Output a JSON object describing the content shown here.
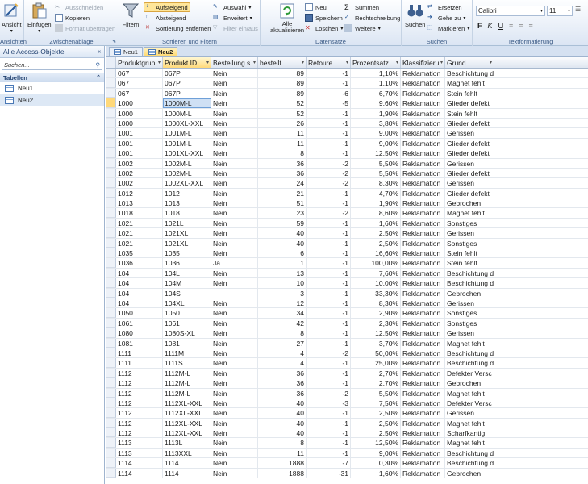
{
  "ribbon": {
    "views": {
      "label": "Ansicht",
      "group": "Ansichten"
    },
    "clipboard": {
      "group": "Zwischenablage",
      "paste": "Einfügen",
      "cut": "Ausschneiden",
      "copy": "Kopieren",
      "format": "Format übertragen"
    },
    "sort": {
      "group": "Sortieren und Filtern",
      "filter": "Filtern",
      "asc": "Aufsteigend",
      "desc": "Absteigend",
      "remove": "Sortierung entfernen",
      "selection": "Auswahl",
      "advanced": "Erweitert",
      "toggle": "Filter ein/aus"
    },
    "records": {
      "group": "Datensätze",
      "refresh": "Alle aktualisieren",
      "new": "Neu",
      "save": "Speichern",
      "delete": "Löschen",
      "totals": "Summen",
      "spelling": "Rechtschreibung",
      "more": "Weitere"
    },
    "find": {
      "group": "Suchen",
      "find": "Suchen",
      "replace": "Ersetzen",
      "goto": "Gehe zu",
      "select": "Markieren"
    },
    "text": {
      "group": "Textformatierung",
      "font": "Calibri",
      "size": "11",
      "bold": "F",
      "italic": "K",
      "underline": "U"
    }
  },
  "nav": {
    "title": "Alle Access-Objekte",
    "search_placeholder": "Suchen...",
    "section": "Tabellen",
    "items": [
      "Neu1",
      "Neu2"
    ]
  },
  "tabs": [
    "Neu1",
    "Neu2"
  ],
  "columns": [
    "Produktgrup",
    "Produkt ID",
    "Bestellung s",
    "bestellt",
    "Retoure",
    "Prozentsatz",
    "Klassifizieru",
    "Grund"
  ],
  "rows": [
    [
      "067",
      "067P",
      "Nein",
      "89",
      "-1",
      "1,10%",
      "Reklamation",
      "Beschichtung d"
    ],
    [
      "067",
      "067P",
      "Nein",
      "89",
      "-1",
      "1,10%",
      "Reklamation",
      "Magnet fehlt"
    ],
    [
      "067",
      "067P",
      "Nein",
      "89",
      "-6",
      "6,70%",
      "Reklamation",
      "Stein fehlt"
    ],
    [
      "1000",
      "1000M-L",
      "Nein",
      "52",
      "-5",
      "9,60%",
      "Reklamation",
      "Glieder defekt"
    ],
    [
      "1000",
      "1000M-L",
      "Nein",
      "52",
      "-1",
      "1,90%",
      "Reklamation",
      "Stein fehlt"
    ],
    [
      "1000",
      "1000XL-XXL",
      "Nein",
      "26",
      "-1",
      "3,80%",
      "Reklamation",
      "Glieder defekt"
    ],
    [
      "1001",
      "1001M-L",
      "Nein",
      "11",
      "-1",
      "9,00%",
      "Reklamation",
      "Gerissen"
    ],
    [
      "1001",
      "1001M-L",
      "Nein",
      "11",
      "-1",
      "9,00%",
      "Reklamation",
      "Glieder defekt"
    ],
    [
      "1001",
      "1001XL-XXL",
      "Nein",
      "8",
      "-1",
      "12,50%",
      "Reklamation",
      "Glieder defekt"
    ],
    [
      "1002",
      "1002M-L",
      "Nein",
      "36",
      "-2",
      "5,50%",
      "Reklamation",
      "Gerissen"
    ],
    [
      "1002",
      "1002M-L",
      "Nein",
      "36",
      "-2",
      "5,50%",
      "Reklamation",
      "Glieder defekt"
    ],
    [
      "1002",
      "1002XL-XXL",
      "Nein",
      "24",
      "-2",
      "8,30%",
      "Reklamation",
      "Gerissen"
    ],
    [
      "1012",
      "1012",
      "Nein",
      "21",
      "-1",
      "4,70%",
      "Reklamation",
      "Glieder defekt"
    ],
    [
      "1013",
      "1013",
      "Nein",
      "51",
      "-1",
      "1,90%",
      "Reklamation",
      "Gebrochen"
    ],
    [
      "1018",
      "1018",
      "Nein",
      "23",
      "-2",
      "8,60%",
      "Reklamation",
      "Magnet fehlt"
    ],
    [
      "1021",
      "1021L",
      "Nein",
      "59",
      "-1",
      "1,60%",
      "Reklamation",
      "Sonstiges"
    ],
    [
      "1021",
      "1021XL",
      "Nein",
      "40",
      "-1",
      "2,50%",
      "Reklamation",
      "Gerissen"
    ],
    [
      "1021",
      "1021XL",
      "Nein",
      "40",
      "-1",
      "2,50%",
      "Reklamation",
      "Sonstiges"
    ],
    [
      "1035",
      "1035",
      "Nein",
      "6",
      "-1",
      "16,60%",
      "Reklamation",
      "Stein fehlt"
    ],
    [
      "1036",
      "1036",
      "Ja",
      "1",
      "-1",
      "100,00%",
      "Reklamation",
      "Stein fehlt"
    ],
    [
      "104",
      "104L",
      "Nein",
      "13",
      "-1",
      "7,60%",
      "Reklamation",
      "Beschichtung d"
    ],
    [
      "104",
      "104M",
      "Nein",
      "10",
      "-1",
      "10,00%",
      "Reklamation",
      "Beschichtung d"
    ],
    [
      "104",
      "104S",
      "",
      "3",
      "-1",
      "33,30%",
      "Reklamation",
      "Gebrochen"
    ],
    [
      "104",
      "104XL",
      "Nein",
      "12",
      "-1",
      "8,30%",
      "Reklamation",
      "Gerissen"
    ],
    [
      "1050",
      "1050",
      "Nein",
      "34",
      "-1",
      "2,90%",
      "Reklamation",
      "Sonstiges"
    ],
    [
      "1061",
      "1061",
      "Nein",
      "42",
      "-1",
      "2,30%",
      "Reklamation",
      "Sonstiges"
    ],
    [
      "1080",
      "1080S-XL",
      "Nein",
      "8",
      "-1",
      "12,50%",
      "Reklamation",
      "Gerissen"
    ],
    [
      "1081",
      "1081",
      "Nein",
      "27",
      "-1",
      "3,70%",
      "Reklamation",
      "Magnet fehlt"
    ],
    [
      "1111",
      "1111M",
      "Nein",
      "4",
      "-2",
      "50,00%",
      "Reklamation",
      "Beschichtung d"
    ],
    [
      "1111",
      "1111S",
      "Nein",
      "4",
      "-1",
      "25,00%",
      "Reklamation",
      "Beschichtung d"
    ],
    [
      "1112",
      "1112M-L",
      "Nein",
      "36",
      "-1",
      "2,70%",
      "Reklamation",
      "Defekter Versc"
    ],
    [
      "1112",
      "1112M-L",
      "Nein",
      "36",
      "-1",
      "2,70%",
      "Reklamation",
      "Gebrochen"
    ],
    [
      "1112",
      "1112M-L",
      "Nein",
      "36",
      "-2",
      "5,50%",
      "Reklamation",
      "Magnet fehlt"
    ],
    [
      "1112",
      "1112XL-XXL",
      "Nein",
      "40",
      "-3",
      "7,50%",
      "Reklamation",
      "Defekter Versc"
    ],
    [
      "1112",
      "1112XL-XXL",
      "Nein",
      "40",
      "-1",
      "2,50%",
      "Reklamation",
      "Gerissen"
    ],
    [
      "1112",
      "1112XL-XXL",
      "Nein",
      "40",
      "-1",
      "2,50%",
      "Reklamation",
      "Magnet fehlt"
    ],
    [
      "1112",
      "1112XL-XXL",
      "Nein",
      "40",
      "-1",
      "2,50%",
      "Reklamation",
      "Scharfkantig"
    ],
    [
      "1113",
      "1113L",
      "Nein",
      "8",
      "-1",
      "12,50%",
      "Reklamation",
      "Magnet fehlt"
    ],
    [
      "1113",
      "1113XXL",
      "Nein",
      "11",
      "-1",
      "9,00%",
      "Reklamation",
      "Beschichtung d"
    ],
    [
      "1114",
      "1114",
      "Nein",
      "1888",
      "-7",
      "0,30%",
      "Reklamation",
      "Beschichtung d"
    ],
    [
      "1114",
      "1114",
      "Nein",
      "1888",
      "-31",
      "1,60%",
      "Reklamation",
      "Gebrochen"
    ]
  ]
}
